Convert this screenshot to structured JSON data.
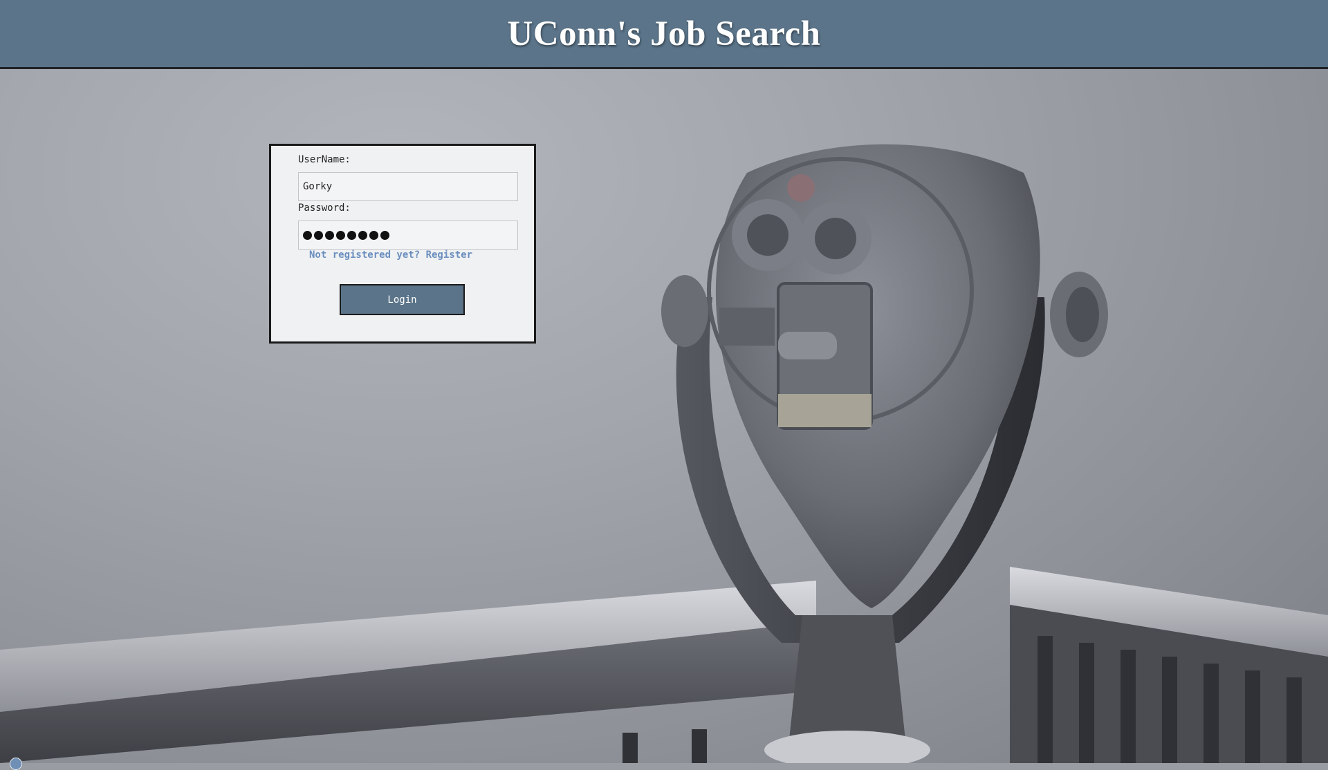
{
  "header": {
    "title": "UConn's Job Search"
  },
  "login": {
    "username_label": "UserName:",
    "username_value": "Gorky",
    "password_label": "Password:",
    "password_length": 8,
    "register_link": "Not registered yet? Register",
    "login_button": "Login"
  },
  "colors": {
    "header_bg": "#5b7489",
    "button_bg": "#5b7489",
    "link": "#6b8fbf"
  },
  "background": {
    "icon": "frosted-binocular-viewer-photo"
  }
}
